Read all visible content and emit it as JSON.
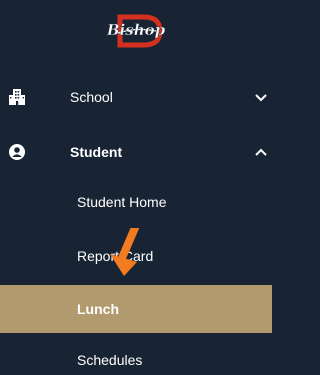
{
  "logo": {
    "text": "Bishop",
    "accent": "#d4301f"
  },
  "nav": {
    "school": {
      "label": "School",
      "icon": "building-icon",
      "expanded": false
    },
    "student": {
      "label": "Student",
      "icon": "user-circle-icon",
      "expanded": true
    },
    "subitems": [
      {
        "label": "Student Home",
        "active": false
      },
      {
        "label": "Report Card",
        "active": false
      },
      {
        "label": "Lunch",
        "active": true
      },
      {
        "label": "Schedules",
        "active": false
      }
    ]
  },
  "colors": {
    "sidebar_bg": "#182434",
    "active_bg": "#b19a6d",
    "annotation_arrow": "#f47c20"
  }
}
